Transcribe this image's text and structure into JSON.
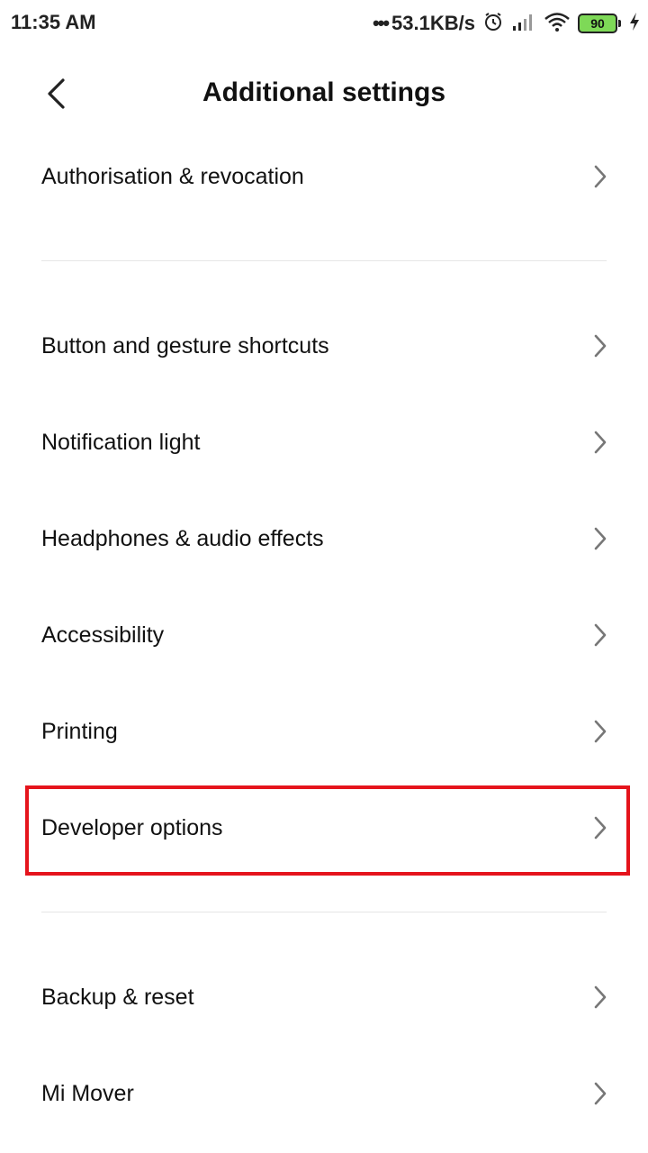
{
  "status_bar": {
    "time": "11:35 AM",
    "network_speed": "53.1KB/s",
    "battery_level": "90",
    "icons": [
      "more-dots-icon",
      "alarm-icon",
      "signal-icon",
      "wifi-icon",
      "battery-icon",
      "charging-icon"
    ]
  },
  "header": {
    "title": "Additional settings",
    "back_icon": "back-arrow-icon"
  },
  "groups": [
    {
      "items": [
        {
          "label": "Authorisation & revocation"
        }
      ]
    },
    {
      "items": [
        {
          "label": "Button and gesture shortcuts"
        },
        {
          "label": "Notification light"
        },
        {
          "label": "Headphones & audio effects"
        },
        {
          "label": "Accessibility"
        },
        {
          "label": "Printing"
        },
        {
          "label": "Developer options",
          "highlighted": true
        }
      ]
    },
    {
      "items": [
        {
          "label": "Backup & reset"
        },
        {
          "label": "Mi Mover"
        }
      ]
    }
  ],
  "colors": {
    "highlight_border": "#e5141c",
    "battery_fill": "#7ed957",
    "divider": "#e6e6e6",
    "chevron": "#777777"
  }
}
